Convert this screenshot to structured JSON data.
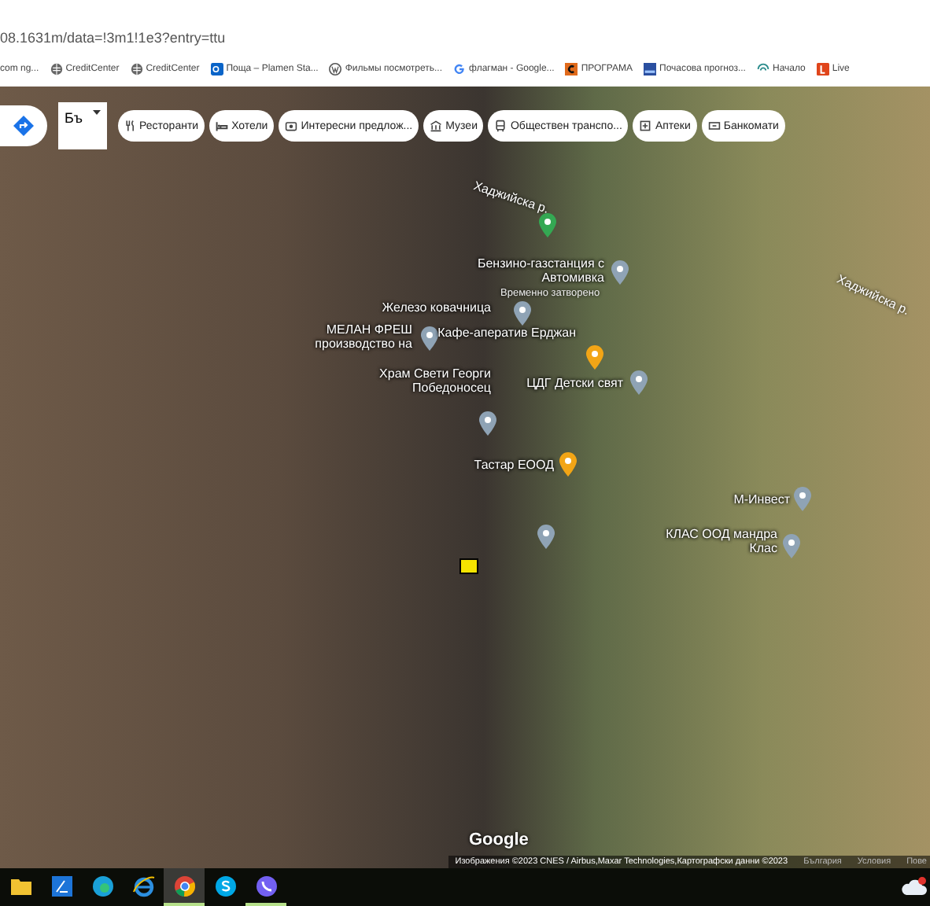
{
  "address_bar": {
    "url": "08.1631m/data=!3m1!1e3?entry=ttu"
  },
  "bookmarks": [
    {
      "label": "com ng...",
      "kind": "none"
    },
    {
      "label": "CreditCenter",
      "kind": "globe"
    },
    {
      "label": "CreditCenter",
      "kind": "globe"
    },
    {
      "label": "Поща – Plamen Sta...",
      "kind": "mail"
    },
    {
      "label": "Фильмы посмотреть...",
      "kind": "wordpress"
    },
    {
      "label": "флагман - Google...",
      "kind": "google"
    },
    {
      "label": "ПРОГРАМА",
      "kind": "letter"
    },
    {
      "label": "Почасова прогноз...",
      "kind": "weather"
    },
    {
      "label": "Начало",
      "kind": "home"
    },
    {
      "label": "Live",
      "kind": "live"
    }
  ],
  "map": {
    "layer_button": {
      "label": "Бъ"
    },
    "chips": [
      {
        "label": "Ресторанти",
        "kind": "restaurant"
      },
      {
        "label": "Хотели",
        "kind": "hotel"
      },
      {
        "label": "Интересни предлож...",
        "kind": "attraction"
      },
      {
        "label": "Музеи",
        "kind": "museum"
      },
      {
        "label": "Обществен транспо...",
        "kind": "transit"
      },
      {
        "label": "Аптеки",
        "kind": "pharmacy"
      },
      {
        "label": "Банкомати",
        "kind": "atm"
      }
    ],
    "pins": [
      {
        "color": "#34a853"
      },
      {
        "label": "Бензино-газстанция с Автомивка",
        "note": "Временно затворено",
        "color": "#8fa3b5"
      },
      {
        "label": "Железо ковачница",
        "color": "#8fa3b5"
      },
      {
        "label": "МЕЛАН ФРЕШ производство на",
        "color": "#8fa3b5"
      },
      {
        "label": "Кафе-аператив Ерджан",
        "color": "#f2a516"
      },
      {
        "label": "Храм Свети Георги Победоносец",
        "color": "#8fa3b5"
      },
      {
        "label": "ЦДГ Детски свят",
        "color": "#8fa3b5"
      },
      {
        "label": "Тастар ЕООД",
        "color": "#f2a516"
      },
      {
        "color": "#8fa3b5"
      },
      {
        "label": "М-Инвест",
        "color": "#8fa3b5"
      },
      {
        "label": "КЛАС ООД мандра Клас",
        "color": "#8fa3b5"
      }
    ],
    "streets": [
      "Хаджийска р.",
      "Хаджийска р."
    ],
    "logo": "Google",
    "attribution": "Изображения ©2023 CNES / Airbus,Maxar Technologies,Картографски данни ©2023",
    "footer_links": [
      "България",
      "Условия",
      "Пове"
    ]
  },
  "taskbar": {
    "apps": [
      {
        "kind": "folder",
        "selected": false,
        "running": false
      },
      {
        "kind": "store",
        "selected": false,
        "running": false
      },
      {
        "kind": "edge",
        "selected": false,
        "running": false
      },
      {
        "kind": "ie",
        "selected": false,
        "running": false
      },
      {
        "kind": "chrome",
        "selected": true,
        "running": true
      },
      {
        "kind": "skype",
        "selected": false,
        "running": false
      },
      {
        "kind": "viber",
        "selected": false,
        "running": true
      }
    ]
  }
}
